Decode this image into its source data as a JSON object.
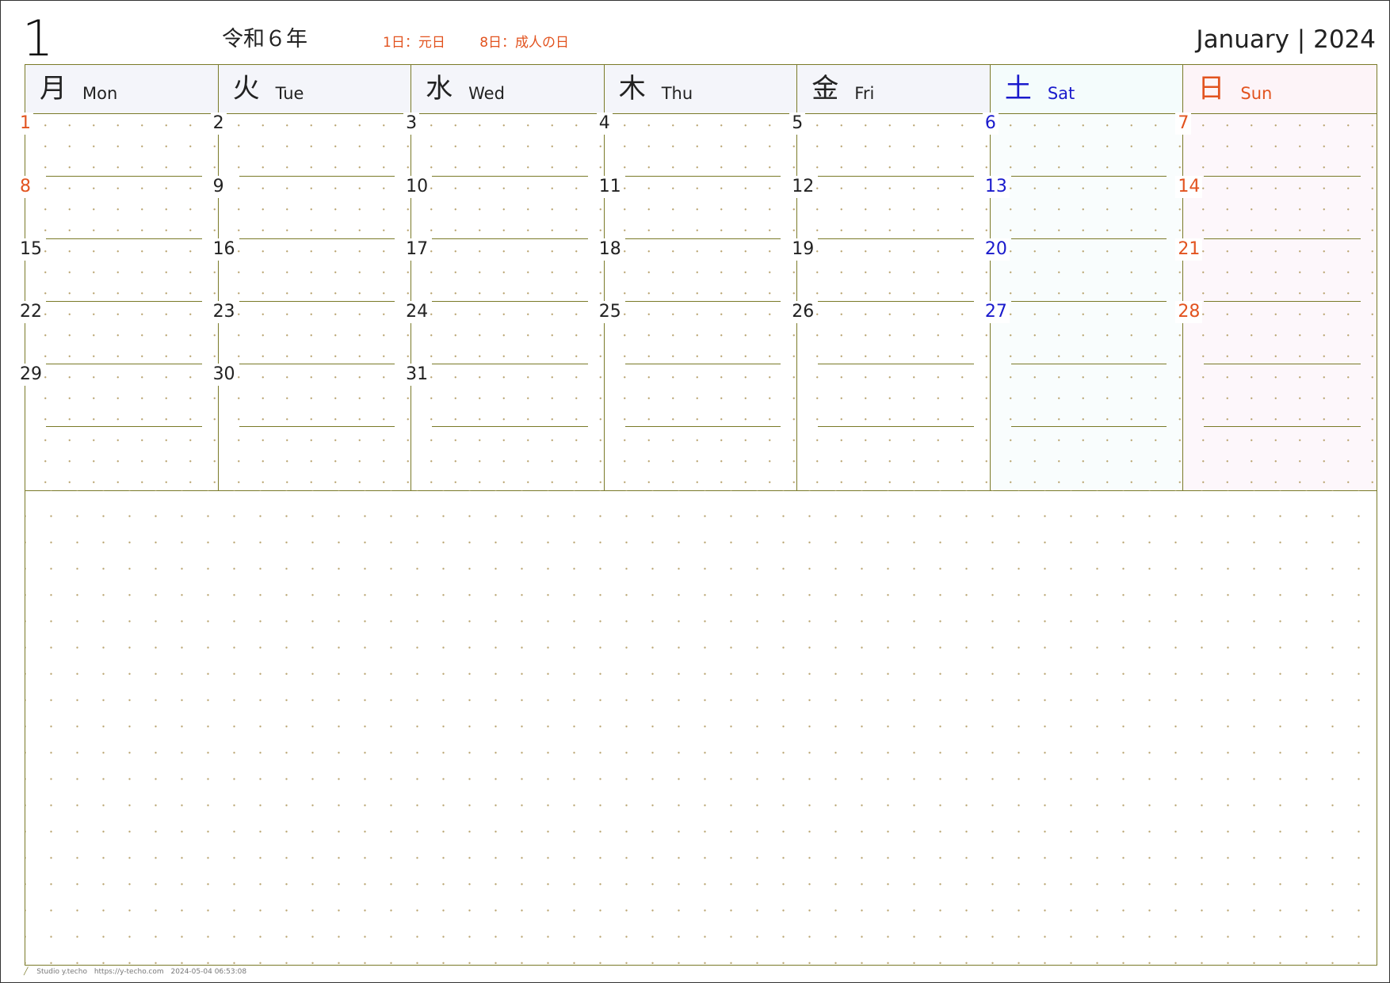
{
  "header": {
    "month_number": "1",
    "era_year": "令和６年",
    "holidays": [
      "1日：元日",
      "8日：成人の日"
    ],
    "month_title": "January | 2024"
  },
  "colors": {
    "weekday": "#222222",
    "saturday": "#1a1acc",
    "sunday_holiday": "#e2531f",
    "grid_line": "#7a7a28",
    "dot": "#b9a470"
  },
  "weekdays": [
    {
      "kanji": "月",
      "en": "Mon",
      "type": "weekday"
    },
    {
      "kanji": "火",
      "en": "Tue",
      "type": "weekday"
    },
    {
      "kanji": "水",
      "en": "Wed",
      "type": "weekday"
    },
    {
      "kanji": "木",
      "en": "Thu",
      "type": "weekday"
    },
    {
      "kanji": "金",
      "en": "Fri",
      "type": "weekday"
    },
    {
      "kanji": "土",
      "en": "Sat",
      "type": "saturday"
    },
    {
      "kanji": "日",
      "en": "Sun",
      "type": "sunday"
    }
  ],
  "weeks": [
    [
      {
        "d": "1",
        "t": "holiday"
      },
      {
        "d": "2",
        "t": "weekday"
      },
      {
        "d": "3",
        "t": "weekday"
      },
      {
        "d": "4",
        "t": "weekday"
      },
      {
        "d": "5",
        "t": "weekday"
      },
      {
        "d": "6",
        "t": "saturday"
      },
      {
        "d": "7",
        "t": "sunday"
      }
    ],
    [
      {
        "d": "8",
        "t": "holiday"
      },
      {
        "d": "9",
        "t": "weekday"
      },
      {
        "d": "10",
        "t": "weekday"
      },
      {
        "d": "11",
        "t": "weekday"
      },
      {
        "d": "12",
        "t": "weekday"
      },
      {
        "d": "13",
        "t": "saturday"
      },
      {
        "d": "14",
        "t": "sunday"
      }
    ],
    [
      {
        "d": "15",
        "t": "weekday"
      },
      {
        "d": "16",
        "t": "weekday"
      },
      {
        "d": "17",
        "t": "weekday"
      },
      {
        "d": "18",
        "t": "weekday"
      },
      {
        "d": "19",
        "t": "weekday"
      },
      {
        "d": "20",
        "t": "saturday"
      },
      {
        "d": "21",
        "t": "sunday"
      }
    ],
    [
      {
        "d": "22",
        "t": "weekday"
      },
      {
        "d": "23",
        "t": "weekday"
      },
      {
        "d": "24",
        "t": "weekday"
      },
      {
        "d": "25",
        "t": "weekday"
      },
      {
        "d": "26",
        "t": "weekday"
      },
      {
        "d": "27",
        "t": "saturday"
      },
      {
        "d": "28",
        "t": "sunday"
      }
    ],
    [
      {
        "d": "29",
        "t": "weekday"
      },
      {
        "d": "30",
        "t": "weekday"
      },
      {
        "d": "31",
        "t": "weekday"
      },
      {
        "d": "",
        "t": "weekday"
      },
      {
        "d": "",
        "t": "weekday"
      },
      {
        "d": "",
        "t": "saturday"
      },
      {
        "d": "",
        "t": "sunday"
      }
    ],
    [
      {
        "d": "",
        "t": "weekday"
      },
      {
        "d": "",
        "t": "weekday"
      },
      {
        "d": "",
        "t": "weekday"
      },
      {
        "d": "",
        "t": "weekday"
      },
      {
        "d": "",
        "t": "weekday"
      },
      {
        "d": "",
        "t": "saturday"
      },
      {
        "d": "",
        "t": "sunday"
      }
    ]
  ],
  "footer": {
    "brand": "Studio y.techo",
    "url": "https://y-techo.com",
    "timestamp": "2024-05-04 06:53:08"
  }
}
